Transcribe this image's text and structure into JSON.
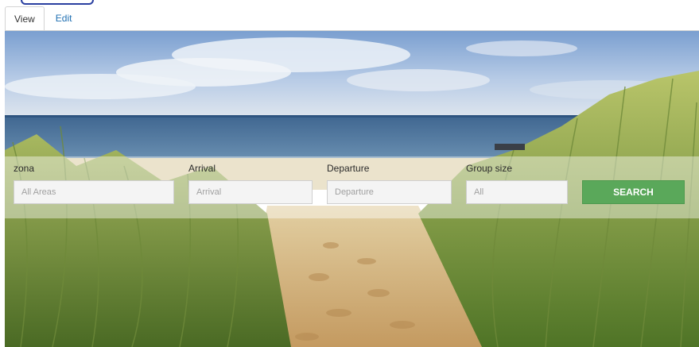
{
  "tabs": [
    {
      "label": "View",
      "active": true
    },
    {
      "label": "Edit",
      "active": false
    }
  ],
  "search_form": {
    "zone": {
      "label": "zona",
      "placeholder": "All Areas"
    },
    "arrival": {
      "label": "Arrival",
      "placeholder": "Arrival"
    },
    "departure": {
      "label": "Departure",
      "placeholder": "Departure"
    },
    "group_size": {
      "label": "Group size",
      "placeholder": "All"
    },
    "search_button": "SEARCH"
  },
  "colors": {
    "tab_link": "#1f6fb2",
    "search_button": "#5aa85a",
    "top_pill_border": "#2a3fa0"
  }
}
